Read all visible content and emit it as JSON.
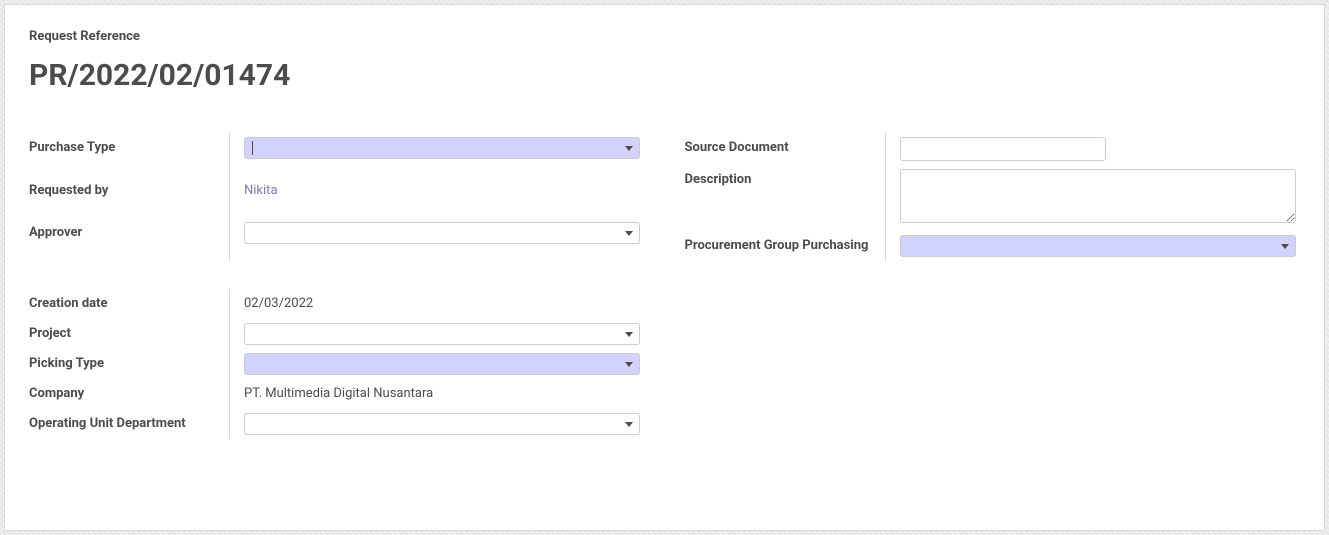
{
  "header": {
    "ref_label": "Request Reference",
    "ref_value": "PR/2022/02/01474"
  },
  "group1_left": {
    "purchase_type": {
      "label": "Purchase Type",
      "value": ""
    },
    "requested_by": {
      "label": "Requested by",
      "value": "Nikita"
    },
    "approver": {
      "label": "Approver",
      "value": ""
    }
  },
  "group1_right": {
    "source_document": {
      "label": "Source Document",
      "value": ""
    },
    "description": {
      "label": "Description",
      "value": ""
    },
    "procurement_group": {
      "label": "Procurement Group Purchasing",
      "value": ""
    }
  },
  "group2": {
    "creation_date": {
      "label": "Creation date",
      "value": "02/03/2022"
    },
    "project": {
      "label": "Project",
      "value": ""
    },
    "picking_type": {
      "label": "Picking Type",
      "value": ""
    },
    "company": {
      "label": "Company",
      "value": "PT. Multimedia Digital Nusantara"
    },
    "operating_unit": {
      "label": "Operating Unit Department",
      "value": ""
    }
  }
}
